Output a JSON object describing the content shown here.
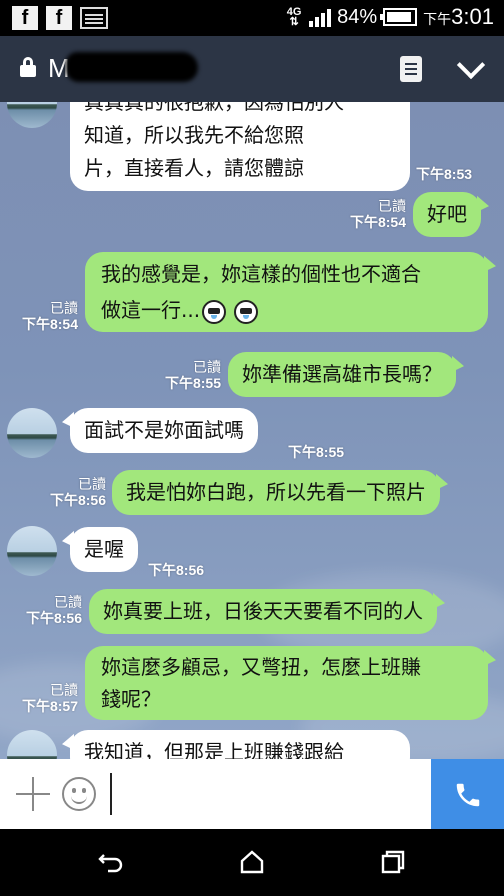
{
  "statusbar": {
    "network": "4G",
    "battery": "84%",
    "ampm": "下午",
    "time": "3:01",
    "battery_level": 0.84
  },
  "header": {
    "title": "M",
    "icons": [
      "lock-icon",
      "note-icon",
      "chevron-down-icon"
    ]
  },
  "messages": [
    {
      "side": "in",
      "lines": [
        "真真真的很抱歉，因為怕別人",
        "知道，所以我先不給您照",
        "片，直接看人，請您體諒"
      ],
      "time": "下午8:53"
    },
    {
      "side": "out",
      "lines": [
        "好吧"
      ],
      "read": "已讀",
      "time": "下午8:54"
    },
    {
      "side": "out",
      "lines": [
        "我的感覺是，妳這樣的個性也不適合",
        "做這一行..."
      ],
      "read": "已讀",
      "time": "下午8:54"
    },
    {
      "side": "out",
      "lines": [
        "妳準備選高雄市長嗎？"
      ],
      "read": "已讀",
      "time": "下午8:55"
    },
    {
      "side": "in",
      "lines": [
        "面試不是妳面試嗎"
      ],
      "time": "下午8:55"
    },
    {
      "side": "out",
      "lines": [
        "我是怕妳白跑，所以先看一下照片"
      ],
      "read": "已讀",
      "time": "下午8:56"
    },
    {
      "side": "in",
      "lines": [
        "是喔"
      ],
      "time": "下午8:56"
    },
    {
      "side": "out",
      "lines": [
        "妳真要上班，日後天天要看不同的人"
      ],
      "read": "已讀",
      "time": "下午8:56"
    },
    {
      "side": "out",
      "lines": [
        "妳這麼多顧忌，又彆扭，怎麼上班賺",
        "錢呢？"
      ],
      "read": "已讀",
      "time": "下午8:57"
    },
    {
      "side": "in",
      "lines": [
        "我知道，但那是上班賺錢跟給"
      ]
    }
  ],
  "input": {
    "placeholder": ""
  },
  "navigation": [
    "back-icon",
    "home-icon",
    "recents-icon"
  ]
}
